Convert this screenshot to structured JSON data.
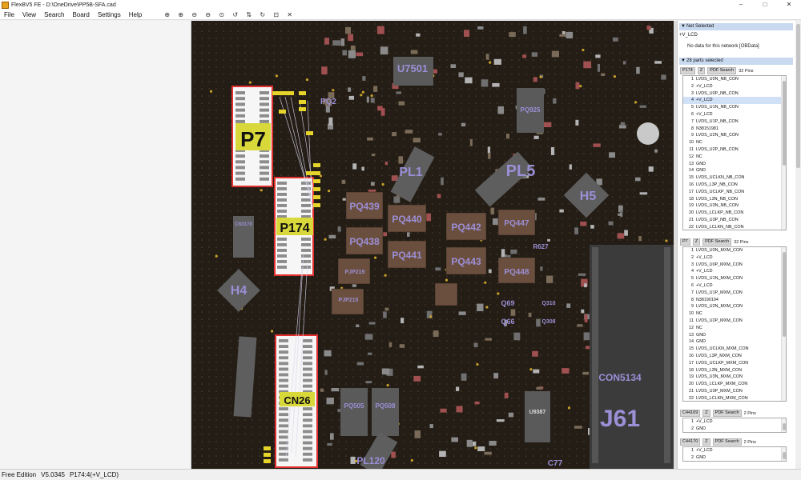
{
  "window": {
    "title": "FlexBV5 FE - D:\\OneDrive\\PP5B-SFA.cad",
    "controls": [
      "–",
      "□",
      "✕"
    ]
  },
  "menu": [
    "File",
    "View",
    "Search",
    "Board",
    "Settings",
    "Help"
  ],
  "toolbar": [
    {
      "icon": "zoom-in-icon",
      "glyph": "⊕"
    },
    {
      "icon": "zoom-in-alt-icon",
      "glyph": "⊕"
    },
    {
      "icon": "zoom-out-icon",
      "glyph": "⊖"
    },
    {
      "icon": "zoom-out-alt-icon",
      "glyph": "⊖"
    },
    {
      "icon": "zoom-fit-icon",
      "glyph": "⊙"
    },
    {
      "icon": "rotate-left-icon",
      "glyph": "↺"
    },
    {
      "icon": "flip-icon",
      "glyph": "⇅"
    },
    {
      "icon": "rotate-right-icon",
      "glyph": "↻"
    },
    {
      "icon": "select-region-icon",
      "glyph": "⊡"
    },
    {
      "icon": "close-icon",
      "glyph": "✕"
    }
  ],
  "board": {
    "labels": {
      "p7": "P7",
      "p174": "P174",
      "cn26": "CN26",
      "pq439": "PQ439",
      "pq438": "PQ438",
      "pq440": "PQ440",
      "pq441": "PQ441",
      "pq442": "PQ442",
      "pq443": "PQ443",
      "pq447": "PQ447",
      "pq448": "PQ448",
      "pl1": "PL1",
      "pl5": "PL5",
      "pl120": "PL120",
      "h5": "H5",
      "h4": "H4",
      "u7501": "U7501",
      "con5134": "CON5134",
      "j61": "J61",
      "pq2": "PQ2",
      "pq925": "PQ925",
      "pq505": "PQ505",
      "pq508": "PQ508",
      "u9387": "U9387",
      "q69": "Q69",
      "q66": "Q66",
      "q310": "Q310",
      "q308": "Q308",
      "cn3": "CN3170",
      "pjp219": "PJP219",
      "pjp215": "PJP215",
      "c77": "C77",
      "r627": "R627"
    }
  },
  "net_panel": {
    "header": "Net Selected",
    "net_name": "+V_LCD",
    "message": "No data for this network [OBData]"
  },
  "parts_panel": {
    "header": "28 parts selected",
    "parts": [
      {
        "name": "P174",
        "z": "Z",
        "pdf": "PDF Search",
        "pins_label": "32 Pins",
        "pins": [
          {
            "n": "1",
            "net": "LVDS_U0N_NB_CON"
          },
          {
            "n": "2",
            "net": "+V_LCD"
          },
          {
            "n": "3",
            "net": "LVDS_U0P_NB_CON"
          },
          {
            "n": "4",
            "net": "+V_LCD",
            "selected": true
          },
          {
            "n": "5",
            "net": "LVDS_U1N_NB_CON"
          },
          {
            "n": "6",
            "net": "+V_LCD"
          },
          {
            "n": "7",
            "net": "LVDS_U1P_NB_CON"
          },
          {
            "n": "8",
            "net": "N38151981"
          },
          {
            "n": "9",
            "net": "LVDS_U2N_NB_CON"
          },
          {
            "n": "10",
            "net": "NC"
          },
          {
            "n": "11",
            "net": "LVDS_U2P_NB_CON"
          },
          {
            "n": "12",
            "net": "NC"
          },
          {
            "n": "13",
            "net": "GND"
          },
          {
            "n": "14",
            "net": "GND"
          },
          {
            "n": "15",
            "net": "LVDS_UCLKN_NB_CON"
          },
          {
            "n": "16",
            "net": "LVDS_L3P_NB_CON"
          },
          {
            "n": "17",
            "net": "LVDS_UCLKP_NB_CON"
          },
          {
            "n": "18",
            "net": "LVDS_L3N_NB_CON"
          },
          {
            "n": "19",
            "net": "LVDS_U3N_NB_CON"
          },
          {
            "n": "20",
            "net": "LVDS_LCLKP_NB_CON"
          },
          {
            "n": "21",
            "net": "LVDS_U3P_NB_CON"
          },
          {
            "n": "22",
            "net": "LVDS_LCLKN_NB_CON"
          }
        ]
      },
      {
        "name": "P7",
        "z": "Z",
        "pdf": "PDF Search",
        "pins_label": "32 Pins",
        "pins": [
          {
            "n": "1",
            "net": "LVDS_U0N_MXM_CON"
          },
          {
            "n": "2",
            "net": "+V_LCD"
          },
          {
            "n": "3",
            "net": "LVDS_U0P_MXM_CON"
          },
          {
            "n": "4",
            "net": "+V_LCD"
          },
          {
            "n": "5",
            "net": "LVDS_U1N_MXM_CON"
          },
          {
            "n": "6",
            "net": "+V_LCD"
          },
          {
            "n": "7",
            "net": "LVDS_U1P_MXM_CON"
          },
          {
            "n": "8",
            "net": "N38190194"
          },
          {
            "n": "9",
            "net": "LVDS_U2N_MXM_CON"
          },
          {
            "n": "10",
            "net": "NC"
          },
          {
            "n": "11",
            "net": "LVDS_U2P_MXM_CON"
          },
          {
            "n": "12",
            "net": "NC"
          },
          {
            "n": "13",
            "net": "GND"
          },
          {
            "n": "14",
            "net": "GND"
          },
          {
            "n": "15",
            "net": "LVDS_UCLKN_MXM_CON"
          },
          {
            "n": "16",
            "net": "LVDS_L3P_MXM_CON"
          },
          {
            "n": "17",
            "net": "LVDS_UCLKP_MXM_CON"
          },
          {
            "n": "18",
            "net": "LVDS_L3N_MXM_CON"
          },
          {
            "n": "19",
            "net": "LVDS_U3N_MXM_CON"
          },
          {
            "n": "20",
            "net": "LVDS_LCLKP_MXM_CON"
          },
          {
            "n": "21",
            "net": "LVDS_U3P_MXM_CON"
          },
          {
            "n": "22",
            "net": "LVDS_LCLKN_MXM_CON"
          }
        ]
      },
      {
        "name": "C44169",
        "z": "Z",
        "pdf": "PDF Search",
        "pins_label": "2 Pins",
        "pins": [
          {
            "n": "1",
            "net": "+V_LCD"
          },
          {
            "n": "2",
            "net": "GND"
          }
        ]
      },
      {
        "name": "C44170",
        "z": "Z",
        "pdf": "PDF Search",
        "pins_label": "2 Pins",
        "pins": [
          {
            "n": "1",
            "net": "+V_LCD"
          },
          {
            "n": "2",
            "net": "GND"
          }
        ]
      }
    ]
  },
  "status": {
    "edition": "Free Edition",
    "version": "V5.0345",
    "selection": "P174:4(+V_LCD)"
  },
  "colors": {
    "board_bg": "#231d15",
    "part_label": "#9b8fd6",
    "highlight_box": "#e23030",
    "selected_label_bg": "#d8d83a",
    "panel_header": "#c9d9f0"
  }
}
